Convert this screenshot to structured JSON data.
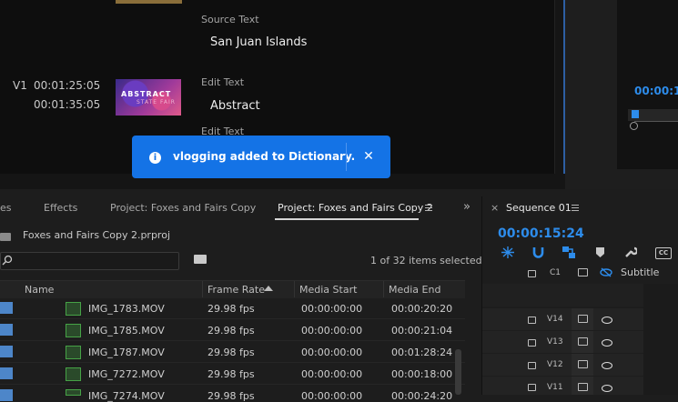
{
  "text_panel": {
    "source_label": "Source Text",
    "source_value": "San Juan Islands",
    "track": "V1",
    "tc_in": "00:01:25:05",
    "tc_out": "00:01:35:05",
    "edit_label": "Edit Text",
    "edit_value": "Abstract",
    "edit_label2": "Edit Text",
    "thumb_title": "ABSTRACT",
    "thumb_sub": "STATE FAIR"
  },
  "toast": {
    "message": "vlogging added to Dictionary.",
    "close_glyph": "✕",
    "info_glyph": "i",
    "color": "#1473e6"
  },
  "right_top": {
    "timecode": "00:00:1"
  },
  "project_panel": {
    "tabs": [
      {
        "label": "es"
      },
      {
        "label": "Effects"
      },
      {
        "label": "Project: Foxes and Fairs Copy"
      },
      {
        "label": "Project: Foxes and Fairs Copy 2"
      }
    ],
    "chevrons": "»",
    "project_file": "Foxes and Fairs Copy 2.prproj",
    "search_placeholder": "",
    "items_count": "1 of 32 items selected",
    "columns": {
      "name": "Name",
      "frame_rate": "Frame Rate",
      "media_start": "Media Start",
      "media_end": "Media End"
    },
    "rows": [
      {
        "name": "IMG_1783.MOV",
        "fps": "29.98 fps",
        "start": "00:00:00:00",
        "end": "00:00:20:20"
      },
      {
        "name": "IMG_1785.MOV",
        "fps": "29.98 fps",
        "start": "00:00:00:00",
        "end": "00:00:21:04"
      },
      {
        "name": "IMG_1787.MOV",
        "fps": "29.98 fps",
        "start": "00:00:00:00",
        "end": "00:01:28:24"
      },
      {
        "name": "IMG_7272.MOV",
        "fps": "29.98 fps",
        "start": "00:00:00:00",
        "end": "00:00:18:00"
      },
      {
        "name": "IMG_7274.MOV",
        "fps": "29.98 fps",
        "start": "00:00:00:00",
        "end": "00:00:24:20"
      }
    ]
  },
  "sequence_panel": {
    "close_glyph": "×",
    "title": "Sequence 01",
    "timecode": "00:00:15:24",
    "tools": [
      "snap-icon",
      "magnet-icon",
      "linked-selection-icon",
      "marker-icon",
      "wrench-icon",
      "captions-icon"
    ],
    "cc_label": "CC",
    "caption_track": "C1",
    "subtitle_label": "Subtitle",
    "tracks": [
      "V14",
      "V13",
      "V12",
      "V11"
    ],
    "accent": "#2d8ceb"
  }
}
